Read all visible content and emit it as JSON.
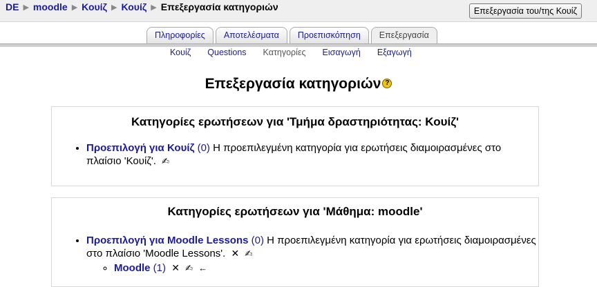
{
  "breadcrumb": {
    "items": [
      "DE",
      "moodle",
      "Κουίζ",
      "Κουίζ"
    ],
    "current": "Επεξεργασία κατηγοριών"
  },
  "header": {
    "edit_quiz_button": "Επεξεργασία του/της Κουίζ"
  },
  "tabs": [
    "Πληροφορίες",
    "Αποτελέσματα",
    "Προεπισκόπηση",
    "Επεξεργασία"
  ],
  "subtabs": [
    "Κουίζ",
    "Questions",
    "Κατηγορίες",
    "Εισαγωγή",
    "Εξαγωγή"
  ],
  "page_title": "Επεξεργασία κατηγοριών",
  "help_icon": "?",
  "sections": [
    {
      "title": "Κατηγορίες ερωτήσεων για 'Τμήμα δραστηριότητας: Κουίζ'",
      "items": [
        {
          "name": "Προεπιλογή για Κουίζ",
          "count": "(0)",
          "description": "Η προεπιλεγμένη κατηγορία για ερωτήσεις διαμοιρασμένες στο πλαίσιο 'Κουίζ'."
        }
      ]
    },
    {
      "title": "Κατηγορίες ερωτήσεων για 'Μάθημα: moodle'",
      "items": [
        {
          "name": "Προεπιλογή για Moodle Lessons",
          "count": "(0)",
          "description": "Η προεπιλεγμένη κατηγορία για ερωτήσεις διαμοιρασμένες στο πλαίσιο 'Moodle Lessons'.",
          "children": [
            {
              "name": "Moodle",
              "count": "(1)"
            }
          ]
        }
      ]
    }
  ],
  "icons": {
    "delete": "✕",
    "edit": "✍",
    "move_left": "←"
  },
  "colors": {
    "link": "#1a1aa8",
    "navbar_bg": "#efefef"
  }
}
